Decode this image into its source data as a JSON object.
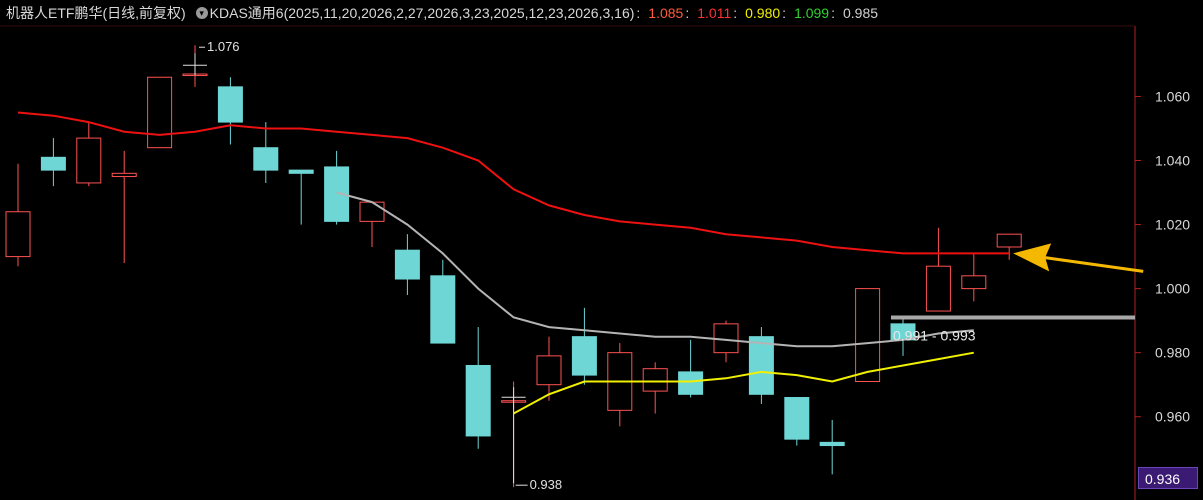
{
  "header": {
    "title": "机器人ETF鹏华(日线,前复权)",
    "indicator_label": "KDAS通用6(2025,11,20,2026,2,27,2026,3,23,2025,12,23,2026,3,16)",
    "separator": ":",
    "values": [
      {
        "text": "1.085",
        "color": "#ff5a3a"
      },
      {
        "text": "1.011",
        "color": "#ff3030"
      },
      {
        "text": "0.980",
        "color": "#f0f000"
      },
      {
        "text": "1.099",
        "color": "#30d030"
      },
      {
        "text": "0.985",
        "color": "#d0d0d0"
      }
    ],
    "icon": "chevron-down-icon"
  },
  "current_price_label": "0.936",
  "chart_data": {
    "type": "candlestick",
    "ylim": [
      0.934,
      1.082
    ],
    "yticks": [
      {
        "value": 1.06,
        "label": "1.060"
      },
      {
        "value": 1.04,
        "label": "1.040"
      },
      {
        "value": 1.02,
        "label": "1.020"
      },
      {
        "value": 1.0,
        "label": "1.000"
      },
      {
        "value": 0.98,
        "label": "0.980"
      },
      {
        "value": 0.96,
        "label": "0.960"
      }
    ],
    "candles": [
      {
        "o": 1.01,
        "c": 1.024,
        "h": 1.039,
        "l": 1.007
      },
      {
        "o": 1.041,
        "c": 1.037,
        "h": 1.047,
        "l": 1.032
      },
      {
        "o": 1.033,
        "c": 1.047,
        "h": 1.052,
        "l": 1.032
      },
      {
        "o": 1.035,
        "c": 1.036,
        "h": 1.043,
        "l": 1.008
      },
      {
        "o": 1.044,
        "c": 1.066,
        "h": 1.066,
        "l": 1.044
      },
      {
        "o": 1.067,
        "c": 1.067,
        "h": 1.076,
        "l": 1.063
      },
      {
        "o": 1.063,
        "c": 1.052,
        "h": 1.066,
        "l": 1.045
      },
      {
        "o": 1.044,
        "c": 1.037,
        "h": 1.052,
        "l": 1.033
      },
      {
        "o": 1.037,
        "c": 1.036,
        "h": 1.037,
        "l": 1.02
      },
      {
        "o": 1.038,
        "c": 1.021,
        "h": 1.043,
        "l": 1.02
      },
      {
        "o": 1.021,
        "c": 1.027,
        "h": 1.027,
        "l": 1.013
      },
      {
        "o": 1.012,
        "c": 1.003,
        "h": 1.017,
        "l": 0.998
      },
      {
        "o": 1.004,
        "c": 0.983,
        "h": 1.009,
        "l": 0.983
      },
      {
        "o": 0.976,
        "c": 0.954,
        "h": 0.988,
        "l": 0.95
      },
      {
        "o": 0.965,
        "c": 0.965,
        "h": 0.971,
        "l": 0.938
      },
      {
        "o": 0.97,
        "c": 0.979,
        "h": 0.985,
        "l": 0.965
      },
      {
        "o": 0.985,
        "c": 0.973,
        "h": 0.994,
        "l": 0.97
      },
      {
        "o": 0.962,
        "c": 0.98,
        "h": 0.983,
        "l": 0.957
      },
      {
        "o": 0.968,
        "c": 0.975,
        "h": 0.977,
        "l": 0.961
      },
      {
        "o": 0.974,
        "c": 0.967,
        "h": 0.984,
        "l": 0.966
      },
      {
        "o": 0.98,
        "c": 0.989,
        "h": 0.99,
        "l": 0.977
      },
      {
        "o": 0.985,
        "c": 0.967,
        "h": 0.988,
        "l": 0.964
      },
      {
        "o": 0.966,
        "c": 0.953,
        "h": 0.966,
        "l": 0.951
      },
      {
        "o": 0.952,
        "c": 0.951,
        "h": 0.959,
        "l": 0.942
      },
      {
        "o": 0.971,
        "c": 1.0,
        "h": 1.0,
        "l": 0.971
      },
      {
        "o": 0.989,
        "c": 0.984,
        "h": 0.991,
        "l": 0.979
      },
      {
        "o": 0.993,
        "c": 1.007,
        "h": 1.019,
        "l": 0.993
      },
      {
        "o": 1.0,
        "c": 1.004,
        "h": 1.011,
        "l": 0.996
      },
      {
        "o": 1.013,
        "c": 1.017,
        "h": 1.017,
        "l": 1.009
      }
    ],
    "lines": [
      {
        "color": "#ee1111",
        "width": 2,
        "start_index": 0,
        "values": [
          1.055,
          1.054,
          1.052,
          1.049,
          1.048,
          1.049,
          1.051,
          1.05,
          1.05,
          1.049,
          1.048,
          1.047,
          1.044,
          1.04,
          1.031,
          1.026,
          1.023,
          1.021,
          1.02,
          1.019,
          1.017,
          1.016,
          1.015,
          1.013,
          1.012,
          1.011,
          1.011,
          1.011,
          1.011
        ]
      },
      {
        "color": "#b4b4b4",
        "width": 2,
        "start_index": 9,
        "values": [
          1.03,
          1.027,
          1.02,
          1.011,
          1.0,
          0.991,
          0.988,
          0.987,
          0.986,
          0.985,
          0.985,
          0.984,
          0.983,
          0.982,
          0.982,
          0.983,
          0.984,
          0.986,
          0.987
        ]
      },
      {
        "color": "#f0f000",
        "width": 2,
        "start_index": 14,
        "values": [
          0.961,
          0.967,
          0.971,
          0.971,
          0.971,
          0.971,
          0.972,
          0.974,
          0.973,
          0.971,
          0.974,
          0.976,
          0.978,
          0.98
        ]
      }
    ],
    "annotations": [
      {
        "type": "high",
        "text": "1.076",
        "index": 5,
        "value": 1.076
      },
      {
        "type": "low",
        "text": "0.938",
        "index": 14,
        "value": 0.938
      },
      {
        "type": "range",
        "text": "0.991 - 0.993",
        "value": 0.991,
        "start_index": 25
      }
    ],
    "arrow": {
      "color": "#f5b800",
      "target_index": 28,
      "target_value": 1.011
    }
  }
}
